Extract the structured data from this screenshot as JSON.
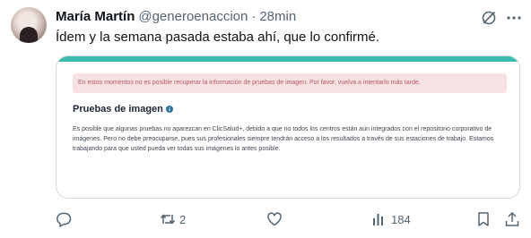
{
  "tweet": {
    "author_name": "María Martín",
    "handle": "@generoenaccion",
    "separator": "·",
    "time": "28min",
    "text": "Ídem y la semana pasada estaba ahí, que lo confirmé."
  },
  "media": {
    "accent_color": "#3bbcae",
    "alert_text": "En estos momentos no es posible recuperar la información de pruebas de imagen. Por favor, vuelva a intentarlo más tarde.",
    "section_title": "Pruebas de imagen",
    "description": "Es posible que algunas pruebas no aparezcan en ClicSalud+, debido a que no todos los centros están aún integrados con el repositorio corporativo de imágenes. Pero no debe preocuparse, pues sus profesionales siempre tendrán acceso a los resultados a través de sus estaciones de trabajo. Estamos trabajando para que usted pueda ver todas sus imágenes lo antes posible."
  },
  "actions": {
    "retweet_count": "2",
    "views_count": "184"
  },
  "icons": [
    "grok-icon",
    "more-icon",
    "info-icon",
    "reply-icon",
    "retweet-icon",
    "like-icon",
    "views-icon",
    "bookmark-icon",
    "share-icon"
  ]
}
